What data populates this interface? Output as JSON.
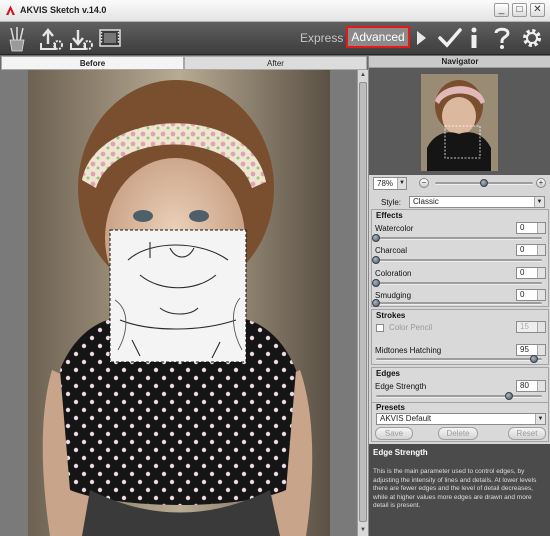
{
  "window": {
    "title": "AKVIS Sketch v.14.0",
    "buttons": {
      "minimize": "_",
      "maximize": "□",
      "close": "✕"
    }
  },
  "toolbar": {
    "icons": [
      "brush-icon",
      "open-settings-icon",
      "save-settings-icon",
      "filmstrip-icon",
      "play-icon",
      "apply-checkmark-icon",
      "info-icon",
      "help-icon",
      "gear-icon"
    ],
    "modes": {
      "express": "Express",
      "advanced": "Advanced"
    },
    "active_mode": "Advanced",
    "highlight_color": "#e81818"
  },
  "view_tabs": {
    "before": "Before",
    "after": "After",
    "active": "Before"
  },
  "navigator": {
    "title": "Navigator",
    "zoom": "78%",
    "zoom_minus": "−",
    "zoom_plus": "+",
    "zoom_slider_value": 0.5
  },
  "style": {
    "label": "Style:",
    "value": "Classic"
  },
  "effects": {
    "title": "Effects",
    "params": [
      {
        "label": "Watercolor",
        "value": "0",
        "level": 0
      },
      {
        "label": "Charcoal",
        "value": "0",
        "level": 0
      },
      {
        "label": "Coloration",
        "value": "0",
        "level": 0
      },
      {
        "label": "Smudging",
        "value": "0",
        "level": 0
      }
    ]
  },
  "strokes": {
    "title": "Strokes",
    "color_pencil": {
      "label": "Color Pencil",
      "value": "15",
      "checked": false,
      "enabled": false
    },
    "midtones_hatching": {
      "label": "Midtones Hatching",
      "value": "95",
      "level": 0.95
    }
  },
  "edges": {
    "title": "Edges",
    "edge_strength": {
      "label": "Edge Strength",
      "value": "80",
      "level": 0.8
    }
  },
  "presets": {
    "title": "Presets",
    "value": "AKVIS Default",
    "save": "Save",
    "delete": "Delete",
    "reset": "Reset"
  },
  "help": {
    "title": "Edge Strength",
    "text": "This is the main parameter used to control edges, by adjusting the intensity of lines and details. At lower levels there are fewer edges and the level of detail decreases, while at higher values more edges are drawn and more detail is present."
  }
}
